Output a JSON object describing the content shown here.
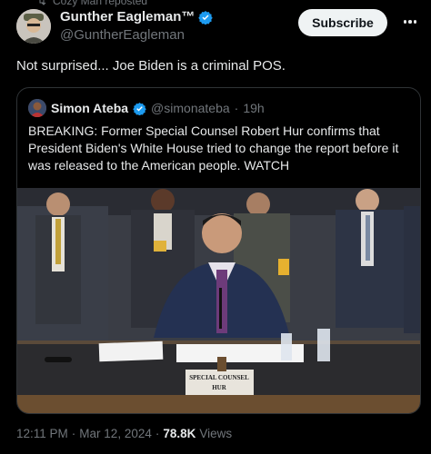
{
  "repost": {
    "text": "Cozy Man reposted"
  },
  "author": {
    "name": "Gunther Eagleman™",
    "handle": "@GuntherEagleman",
    "verified_color": "#1d9bf0"
  },
  "subscribe_label": "Subscribe",
  "post": {
    "text": "Not surprised...  Joe Biden is a criminal POS."
  },
  "quote": {
    "name": "Simon Ateba",
    "handle": "@simonateba",
    "separator": "·",
    "time": "19h",
    "text": "BREAKING: Former Special Counsel Robert Hur confirms that President Biden's White House tried to change the report before it was released to the American people. WATCH",
    "nameplate_line1": "SPECIAL COUNSEL",
    "nameplate_line2": "HUR"
  },
  "meta": {
    "time": "12:11 PM",
    "date": "Mar 12, 2024",
    "separator": "·",
    "views_count": "78.8K",
    "views_label": "Views"
  },
  "colors": {
    "background": "#000000",
    "text_primary": "#e7e9ea",
    "text_secondary": "#71767b",
    "accent": "#1d9bf0",
    "border": "#2f3336"
  }
}
